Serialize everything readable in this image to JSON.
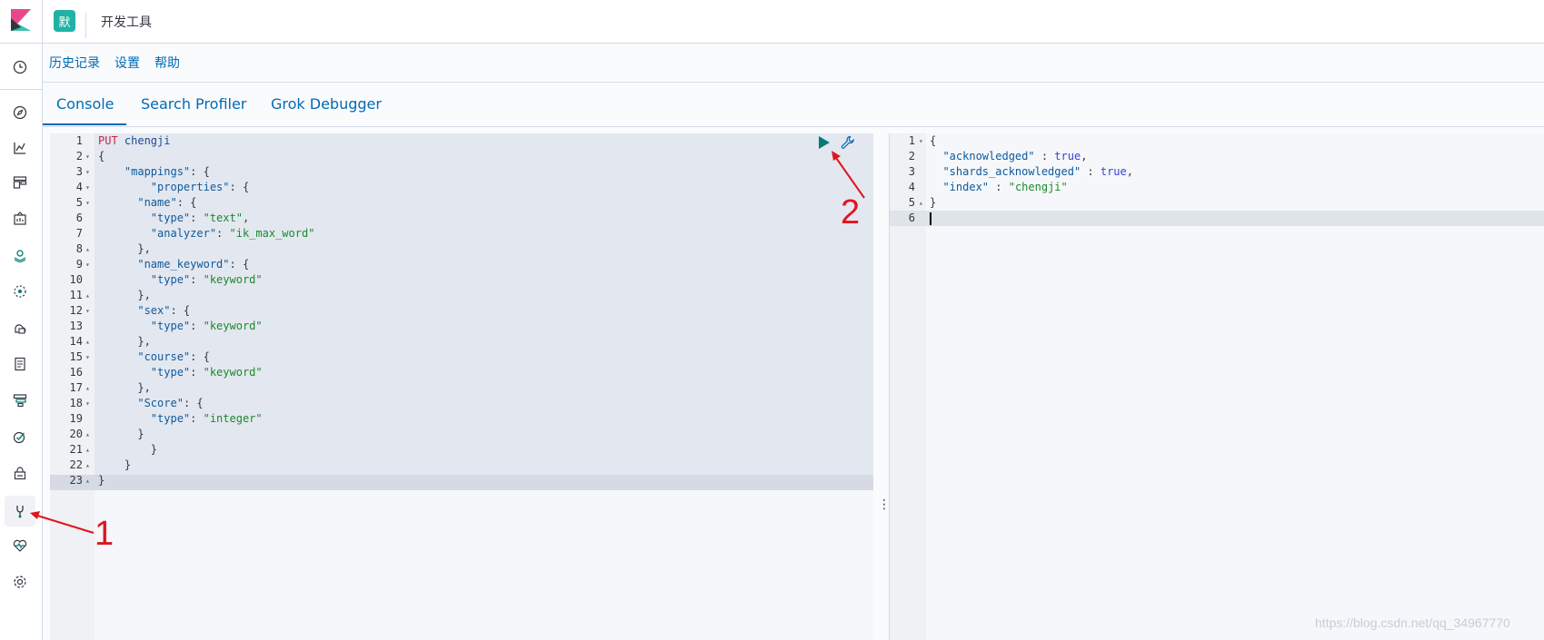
{
  "header": {
    "space_badge": "默",
    "breadcrumb": "开发工具"
  },
  "toplinks": [
    "历史记录",
    "设置",
    "帮助"
  ],
  "tabs": [
    "Console",
    "Search Profiler",
    "Grok Debugger"
  ],
  "sidebar_icons": [
    "clock-icon",
    "compass-icon",
    "visualize-icon",
    "dashboard-icon",
    "canvas-icon",
    "maps-icon",
    "ml-icon",
    "infrastructure-icon",
    "logs-icon",
    "apm-icon",
    "uptime-icon",
    "siem-icon",
    "dev-tools-icon",
    "monitoring-icon",
    "management-icon"
  ],
  "editor": {
    "lines": [
      {
        "n": "1",
        "fold": "",
        "segs": [
          [
            "k-method",
            "PUT "
          ],
          [
            "k-url",
            "chengji"
          ]
        ]
      },
      {
        "n": "2",
        "fold": "▾",
        "segs": [
          [
            "",
            "{"
          ]
        ]
      },
      {
        "n": "3",
        "fold": "▾",
        "segs": [
          [
            "",
            "    "
          ],
          [
            "k-key",
            "\"mappings\""
          ],
          [
            "",
            ": {"
          ]
        ]
      },
      {
        "n": "4",
        "fold": "▾",
        "segs": [
          [
            "",
            "        "
          ],
          [
            "k-key",
            "\"properties\""
          ],
          [
            "",
            ": {"
          ]
        ]
      },
      {
        "n": "5",
        "fold": "▾",
        "segs": [
          [
            "",
            "      "
          ],
          [
            "k-key",
            "\"name\""
          ],
          [
            "",
            ": {"
          ]
        ]
      },
      {
        "n": "6",
        "fold": "",
        "segs": [
          [
            "",
            "        "
          ],
          [
            "k-key",
            "\"type\""
          ],
          [
            "",
            ": "
          ],
          [
            "k-str",
            "\"text\""
          ],
          [
            "",
            ","
          ]
        ]
      },
      {
        "n": "7",
        "fold": "",
        "segs": [
          [
            "",
            "        "
          ],
          [
            "k-key",
            "\"analyzer\""
          ],
          [
            "",
            ": "
          ],
          [
            "k-str",
            "\"ik_max_word\""
          ]
        ]
      },
      {
        "n": "8",
        "fold": "▴",
        "segs": [
          [
            "",
            "      },"
          ]
        ]
      },
      {
        "n": "9",
        "fold": "▾",
        "segs": [
          [
            "",
            "      "
          ],
          [
            "k-key",
            "\"name_keyword\""
          ],
          [
            "",
            ": {"
          ]
        ]
      },
      {
        "n": "10",
        "fold": "",
        "segs": [
          [
            "",
            "        "
          ],
          [
            "k-key",
            "\"type\""
          ],
          [
            "",
            ": "
          ],
          [
            "k-str",
            "\"keyword\""
          ]
        ]
      },
      {
        "n": "11",
        "fold": "▴",
        "segs": [
          [
            "",
            "      },"
          ]
        ]
      },
      {
        "n": "12",
        "fold": "▾",
        "segs": [
          [
            "",
            "      "
          ],
          [
            "k-key",
            "\"sex\""
          ],
          [
            "",
            ": {"
          ]
        ]
      },
      {
        "n": "13",
        "fold": "",
        "segs": [
          [
            "",
            "        "
          ],
          [
            "k-key",
            "\"type\""
          ],
          [
            "",
            ": "
          ],
          [
            "k-str",
            "\"keyword\""
          ]
        ]
      },
      {
        "n": "14",
        "fold": "▴",
        "segs": [
          [
            "",
            "      },"
          ]
        ]
      },
      {
        "n": "15",
        "fold": "▾",
        "segs": [
          [
            "",
            "      "
          ],
          [
            "k-key",
            "\"course\""
          ],
          [
            "",
            ": {"
          ]
        ]
      },
      {
        "n": "16",
        "fold": "",
        "segs": [
          [
            "",
            "        "
          ],
          [
            "k-key",
            "\"type\""
          ],
          [
            "",
            ": "
          ],
          [
            "k-str",
            "\"keyword\""
          ]
        ]
      },
      {
        "n": "17",
        "fold": "▴",
        "segs": [
          [
            "",
            "      },"
          ]
        ]
      },
      {
        "n": "18",
        "fold": "▾",
        "segs": [
          [
            "",
            "      "
          ],
          [
            "k-key",
            "\"Score\""
          ],
          [
            "",
            ": {"
          ]
        ]
      },
      {
        "n": "19",
        "fold": "",
        "segs": [
          [
            "",
            "        "
          ],
          [
            "k-key",
            "\"type\""
          ],
          [
            "",
            ": "
          ],
          [
            "k-str",
            "\"integer\""
          ]
        ]
      },
      {
        "n": "20",
        "fold": "▴",
        "segs": [
          [
            "",
            "      }"
          ]
        ]
      },
      {
        "n": "21",
        "fold": "▴",
        "segs": [
          [
            "",
            "        }"
          ]
        ]
      },
      {
        "n": "22",
        "fold": "▴",
        "segs": [
          [
            "",
            "    }"
          ]
        ]
      },
      {
        "n": "23",
        "fold": "▴",
        "segs": [
          [
            "",
            "}"
          ]
        ]
      }
    ]
  },
  "output": {
    "lines": [
      {
        "n": "1",
        "fold": "▾",
        "segs": [
          [
            "",
            "{"
          ]
        ]
      },
      {
        "n": "2",
        "fold": "",
        "segs": [
          [
            "",
            "  "
          ],
          [
            "k-key",
            "\"acknowledged\""
          ],
          [
            "",
            " : "
          ],
          [
            "k-bool",
            "true"
          ],
          [
            "",
            ","
          ]
        ]
      },
      {
        "n": "3",
        "fold": "",
        "segs": [
          [
            "",
            "  "
          ],
          [
            "k-key",
            "\"shards_acknowledged\""
          ],
          [
            "",
            " : "
          ],
          [
            "k-bool",
            "true"
          ],
          [
            "",
            ","
          ]
        ]
      },
      {
        "n": "4",
        "fold": "",
        "segs": [
          [
            "",
            "  "
          ],
          [
            "k-key",
            "\"index\""
          ],
          [
            "",
            " : "
          ],
          [
            "k-str",
            "\"chengji\""
          ]
        ]
      },
      {
        "n": "5",
        "fold": "▴",
        "segs": [
          [
            "",
            "}"
          ]
        ]
      },
      {
        "n": "6",
        "fold": "",
        "segs": [
          [
            "",
            ""
          ]
        ]
      }
    ]
  },
  "annotations": [
    "1",
    "2"
  ],
  "watermark": "https://blog.csdn.net/qq_34967770",
  "colors": {
    "accent": "#006bb4",
    "badge": "#20b2a5",
    "play": "#017d73",
    "arrow": "#e0141e"
  }
}
